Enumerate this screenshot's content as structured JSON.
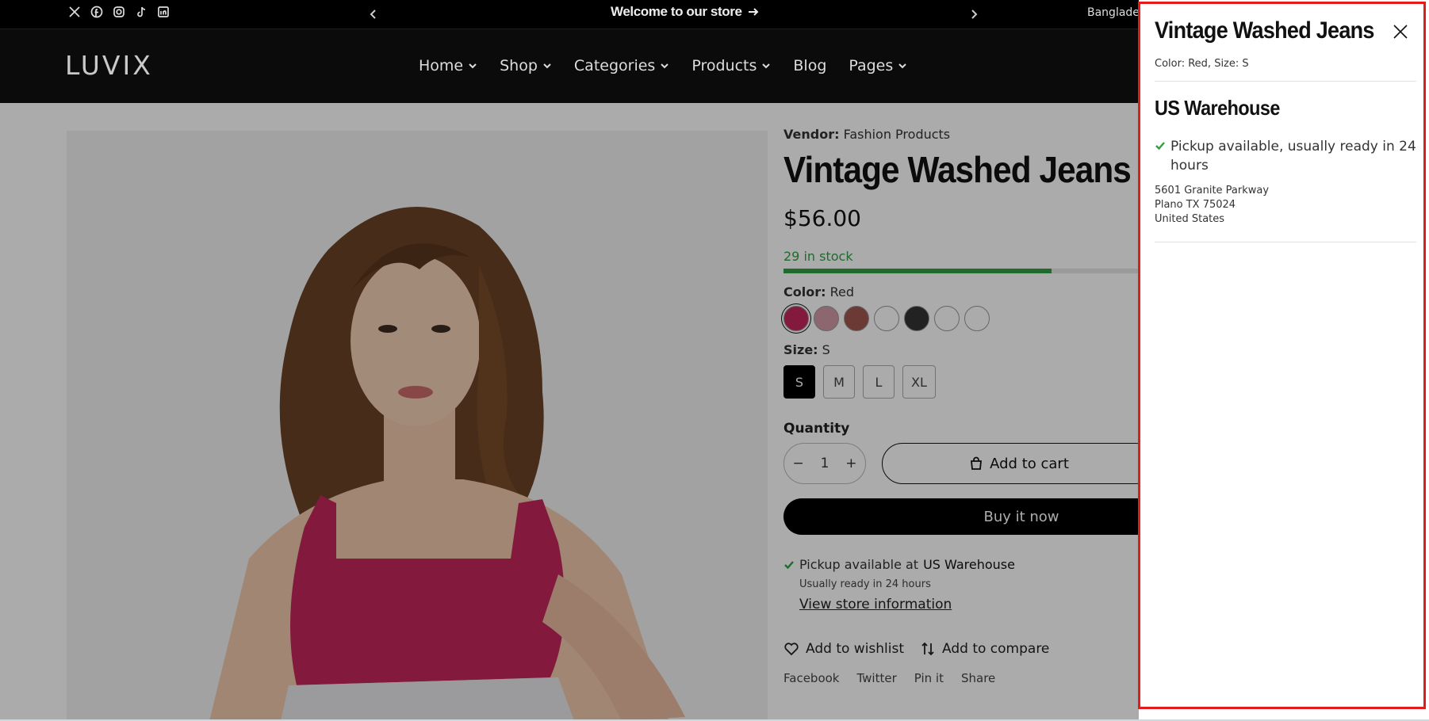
{
  "topbar": {
    "socials": [
      "x-icon",
      "facebook-icon",
      "instagram-icon",
      "tiktok-icon",
      "linkedin-icon"
    ],
    "announcement": "Welcome to our store",
    "country": "Banglade"
  },
  "header": {
    "logo": "LUVIX",
    "nav": [
      "Home",
      "Shop",
      "Categories",
      "Products",
      "Blog",
      "Pages"
    ]
  },
  "product": {
    "vendor_label": "Vendor:",
    "vendor": "Fashion Products",
    "title": "Vintage Washed Jeans",
    "price": "$56.00",
    "stock_text": "29 in stock",
    "stock_level": 0.72,
    "color_label": "Color:",
    "color_value": "Red",
    "swatch_colors": [
      "#c4285c",
      "#d39aa8",
      "#a0574f",
      "#ffffff",
      "#333333",
      "#ffffff",
      "#ffffff"
    ],
    "size_label": "Size:",
    "size_value": "S",
    "sizes": [
      "S",
      "M",
      "L",
      "XL"
    ],
    "quantity_label": "Quantity",
    "quantity": "1",
    "qty_minus": "−",
    "qty_plus": "+",
    "add_to_cart": "Add to cart",
    "buy_now": "Buy it now",
    "pickup_prefix": "Pickup available at",
    "pickup_store": "US Warehouse",
    "pickup_sub": "Usually ready in 24 hours",
    "view_store": "View store information",
    "wishlist": "Add to wishlist",
    "compare": "Add to compare",
    "share": [
      "Facebook",
      "Twitter",
      "Pin it",
      "Share"
    ]
  },
  "drawer": {
    "title": "Vintage Washed Jeans",
    "variant": "Color: Red, Size: S",
    "store_name": "US Warehouse",
    "pickup_text": "Pickup available, usually ready in 24 hours",
    "address_line1": "5601 Granite Parkway",
    "address_line2": "Plano TX 75024",
    "address_line3": "United States"
  },
  "colors": {
    "accent_green": "#2ea043",
    "highlight_red": "#e31b1b"
  }
}
